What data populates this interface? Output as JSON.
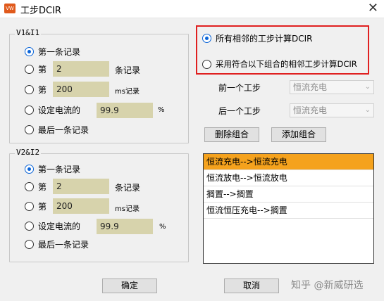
{
  "window": {
    "title": "工步DCIR",
    "icon_text": "VW"
  },
  "group1": {
    "label": "V1&I1",
    "options": [
      "第一条记录",
      "第",
      "第",
      "设定电流的",
      "最后一条记录"
    ],
    "record_no": "2",
    "record_unit": "条记录",
    "ms_value": "200",
    "ms_unit": "ms记录",
    "current_value": "99.9",
    "current_unit": "%",
    "selected": 0
  },
  "group2": {
    "label": "V2&I2",
    "options": [
      "第一条记录",
      "第",
      "第",
      "设定电流的",
      "最后一条记录"
    ],
    "record_no": "2",
    "record_unit": "条记录",
    "ms_value": "200",
    "ms_unit": "ms记录",
    "current_value": "99.9",
    "current_unit": "%",
    "selected": 0
  },
  "mode": {
    "option_all": "所有相邻的工步计算DCIR",
    "option_combo": "采用符合以下组合的相邻工步计算DCIR",
    "selected": "all"
  },
  "combos": {
    "prev_label": "前一个工步",
    "prev_value": "恒流充电",
    "next_label": "后一个工步",
    "next_value": "恒流充电"
  },
  "buttons": {
    "delete": "删除组合",
    "add": "添加组合",
    "ok": "确定",
    "cancel": "取消"
  },
  "list": [
    "恒流充电-->恒流充电",
    "恒流放电-->恒流放电",
    "搁置-->搁置",
    "恒流恒压充电-->搁置"
  ],
  "watermark": "知乎 @新威研选",
  "colors": {
    "highlight": "#e02020",
    "selected_row": "#f5a21d",
    "input_fill": "#d7d3ac"
  }
}
